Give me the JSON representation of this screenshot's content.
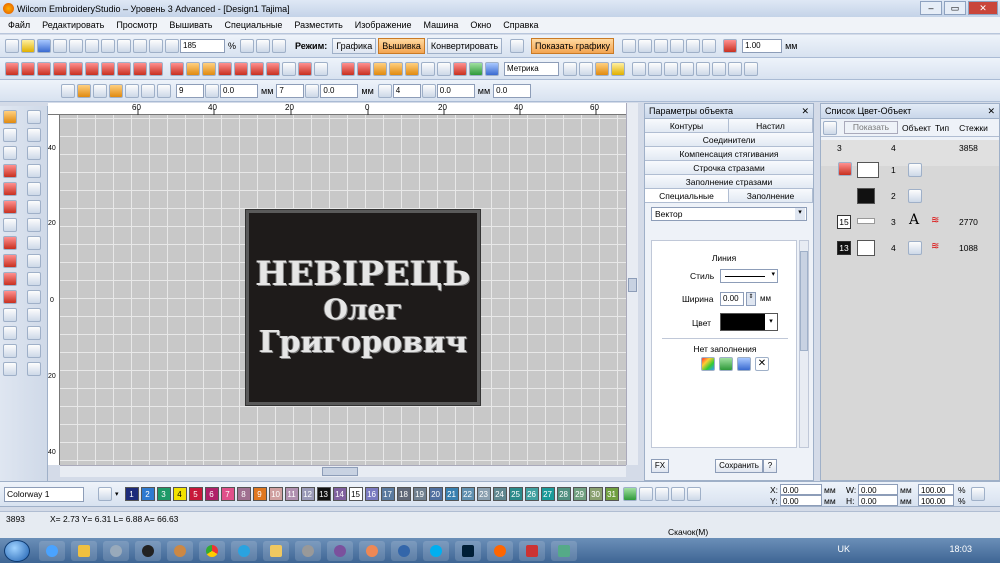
{
  "window": {
    "title": "Wilcom EmbroideryStudio – Уровень 3 Advanced - [Design1        Tajima]"
  },
  "menu": [
    "Файл",
    "Редактировать",
    "Просмотр",
    "Вышивать",
    "Специальные",
    "Разместить",
    "Изображение",
    "Машина",
    "Окно",
    "Справка"
  ],
  "toolbar1": {
    "zoom": "185",
    "zoom_unit": "%",
    "mode_label": "Режим:",
    "mode_graphics": "Графика",
    "mode_embroidery": "Вышивка",
    "convert": "Конвертировать",
    "show_graphics": "Показать графику",
    "scale_value": "1.00",
    "scale_unit": "мм"
  },
  "toolbar2": {
    "units": "Метрика"
  },
  "toolbar3": {
    "f1": "9",
    "f2": "0.0",
    "f2_unit": "мм",
    "f3": "7",
    "f4": "0.0",
    "f4_unit": "мм",
    "f5": "4",
    "f6": "0.0",
    "f6_unit": "мм",
    "f7": "0.0"
  },
  "ruler": {
    "top": [
      "60",
      "40",
      "20",
      "0",
      "20",
      "40",
      "60"
    ],
    "left": [
      "40",
      "20",
      "0",
      "20",
      "40"
    ]
  },
  "design": {
    "line1": "НЕВІРЕЦЬ",
    "line2": "Олег",
    "line3": "Григорович"
  },
  "object_panel": {
    "title": "Параметры объекта",
    "tab_contours": "Контуры",
    "tab_settings": "Настил",
    "rows": [
      "Соединители",
      "Компенсация стягивания",
      "Строчка стразами",
      "Заполнение стразами"
    ],
    "tab_special": "Специальные",
    "tab_fill": "Заполнение",
    "vector_select": "Вектор",
    "line_label": "Линия",
    "style_label": "Стиль",
    "width_label": "Ширина",
    "width_value": "0.00",
    "width_unit": "мм",
    "color_label": "Цвет",
    "no_fill_label": "Нет заполнения",
    "fx": "FX",
    "save": "Сохранить",
    "help": "?"
  },
  "color_panel": {
    "title": "Список Цвет-Объект",
    "show_btn": "Показать",
    "col_object": "Объект",
    "col_type": "Тип",
    "col_stitches": "Стежки",
    "rows": [
      {
        "a": "3",
        "b": "4",
        "c": "3858"
      },
      {
        "a": "",
        "b": "1",
        "c": ""
      },
      {
        "a": "",
        "b": "2",
        "c": ""
      },
      {
        "a": "15",
        "b": "3",
        "c": "2770"
      },
      {
        "a": "13",
        "b": "4",
        "c": "1088"
      }
    ]
  },
  "colorway": {
    "name": "Colorway 1",
    "swatches": [
      {
        "n": "1",
        "c": "#1c2a7a"
      },
      {
        "n": "2",
        "c": "#2e7ad0"
      },
      {
        "n": "3",
        "c": "#1d9a68"
      },
      {
        "n": "4",
        "c": "#f2e200"
      },
      {
        "n": "5",
        "c": "#c8183a"
      },
      {
        "n": "6",
        "c": "#b0206a"
      },
      {
        "n": "7",
        "c": "#e0508a"
      },
      {
        "n": "8",
        "c": "#a07090"
      },
      {
        "n": "9",
        "c": "#e07820"
      },
      {
        "n": "10",
        "c": "#d0a0a0"
      },
      {
        "n": "11",
        "c": "#b090b0"
      },
      {
        "n": "12",
        "c": "#9a9ab8"
      },
      {
        "n": "13",
        "c": "#111111"
      },
      {
        "n": "14",
        "c": "#8060a0"
      },
      {
        "n": "15",
        "c": "#ffffff"
      },
      {
        "n": "16",
        "c": "#7a7ac0"
      },
      {
        "n": "17",
        "c": "#5a7aa0"
      },
      {
        "n": "18",
        "c": "#606878"
      },
      {
        "n": "19",
        "c": "#708090"
      },
      {
        "n": "20",
        "c": "#5070a0"
      },
      {
        "n": "21",
        "c": "#3880b0"
      },
      {
        "n": "22",
        "c": "#6090b0"
      },
      {
        "n": "23",
        "c": "#8aa0b0"
      },
      {
        "n": "24",
        "c": "#608890"
      },
      {
        "n": "25",
        "c": "#2a8a8a"
      },
      {
        "n": "26",
        "c": "#40a0a0"
      },
      {
        "n": "27",
        "c": "#1a9a9a"
      },
      {
        "n": "28",
        "c": "#509080"
      },
      {
        "n": "29",
        "c": "#70a080"
      },
      {
        "n": "30",
        "c": "#8aa070"
      },
      {
        "n": "31",
        "c": "#70a040"
      }
    ]
  },
  "transform": {
    "x_label": "X:",
    "x": "0.00",
    "y_label": "Y:",
    "y": "0.00",
    "unit": "мм",
    "w_label": "W:",
    "w": "0.00",
    "h_label": "H:",
    "h": "0.00",
    "wp": "100.00",
    "hp": "100.00",
    "pct": "%"
  },
  "status": {
    "stitches": "3893",
    "coords": "X=  2.73 Y=   6.31 L=   6.88 A=  66.63",
    "file": "Скачок(M)"
  },
  "taskbar": {
    "lang": "UK",
    "time": "18:03"
  }
}
